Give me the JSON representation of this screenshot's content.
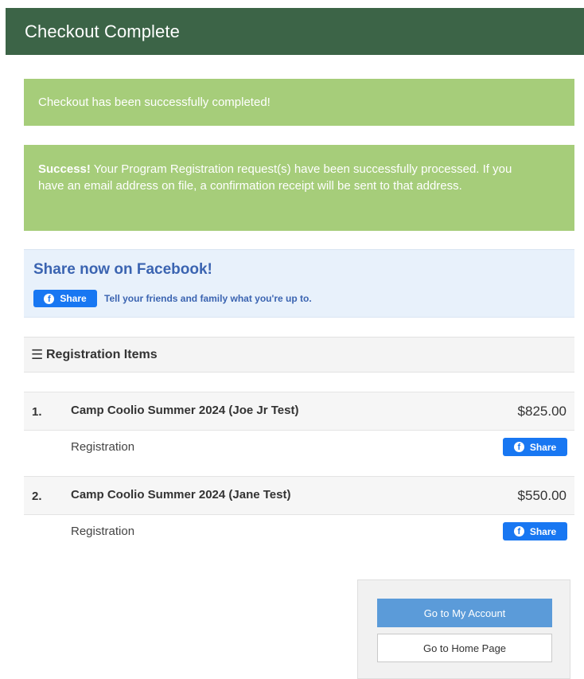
{
  "header": {
    "title": "Checkout Complete"
  },
  "alerts": {
    "complete_message": "Checkout has been successfully completed!",
    "success_label": "Success!",
    "success_message": " Your Program Registration request(s) have been successfully processed. If you have an email address on file, a confirmation receipt will be sent to that address."
  },
  "facebook": {
    "heading": "Share now on Facebook!",
    "share_label": "Share",
    "tagline": "Tell your friends and family what you're up to.",
    "icon": "facebook-icon",
    "brand_color": "#1877f2"
  },
  "registration": {
    "title": "Registration Items",
    "items": [
      {
        "number": "1.",
        "name": "Camp Coolio Summer 2024 (Joe Jr Test)",
        "price": "$825.00",
        "type": "Registration",
        "share_label": "Share"
      },
      {
        "number": "2.",
        "name": "Camp Coolio Summer 2024 (Jane Test)",
        "price": "$550.00",
        "type": "Registration",
        "share_label": "Share"
      }
    ]
  },
  "actions": {
    "my_account_label": "Go to My Account",
    "home_page_label": "Go to Home Page"
  },
  "colors": {
    "header_bg": "#3c6447",
    "alert_bg": "#a6cd7a",
    "primary_button": "#5b9bd9"
  }
}
